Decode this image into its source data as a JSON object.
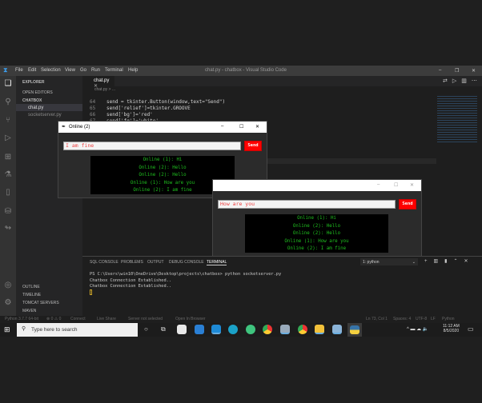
{
  "vscode": {
    "window_title": "chat.py - chatbox - Visual Studio Code",
    "menu": [
      "File",
      "Edit",
      "Selection",
      "View",
      "Go",
      "Run",
      "Terminal",
      "Help"
    ],
    "explorer": {
      "title": "EXPLORER",
      "open_editors": "OPEN EDITORS",
      "folder": "CHATBOX",
      "files": [
        "chat.py",
        "socketserver.py"
      ],
      "sections": [
        "OUTLINE",
        "TIMELINE",
        "TOMCAT SERVERS",
        "MAVEN"
      ]
    },
    "tab": "chat.py",
    "breadcrumb": "chat.py > ...",
    "code": [
      {
        "n": "64",
        "t": "send = tkinter.Button(window,text=\"Send\")"
      },
      {
        "n": "65",
        "t": "send['relief']=tkinter.GROOVE"
      },
      {
        "n": "66",
        "t": "send['bg']='red'"
      },
      {
        "n": "67",
        "t": "send['fg']='white'"
      }
    ],
    "panel_tabs": [
      "SQL CONSOLE",
      "PROBLEMS",
      "OUTPUT",
      "DEBUG CONSOLE",
      "TERMINAL"
    ],
    "terminal_select": "1: python",
    "terminal": [
      "PS C:\\Users\\win10\\OneDrive\\Desktop\\projects\\chatbox> python socketserver.py",
      "Chatbox Connection Established..",
      "Chatbox Connection Established.."
    ],
    "status_left": [
      "Python 3.7.7 64-bit",
      "⊗ 0 ⚠ 0",
      "Connect",
      "Live Share",
      "Server not selected",
      "Open In Browser"
    ],
    "status_right": [
      "Ln 73, Col 1",
      "Spaces: 4",
      "UTF-8",
      "LF",
      "Python"
    ]
  },
  "chat1": {
    "title": "Online (2)",
    "input": "I am fine",
    "send": "Send",
    "messages": [
      "Online (1):  Hi",
      "Online (2):  Hello",
      "Online (2):  Hello",
      "Online (1):  How are you",
      "Online (2):  I am fine"
    ]
  },
  "chat2": {
    "title": "",
    "input": "How are you",
    "send": "Send",
    "messages": [
      "Online (1):  Hi",
      "Online (2):  Hello",
      "Online (2):  Hello",
      "Online (1):  How are you",
      "Online (2):  I am fine"
    ]
  },
  "taskbar": {
    "search": "Type here to search",
    "time": "11:12 AM",
    "date": "8/5/2020"
  }
}
